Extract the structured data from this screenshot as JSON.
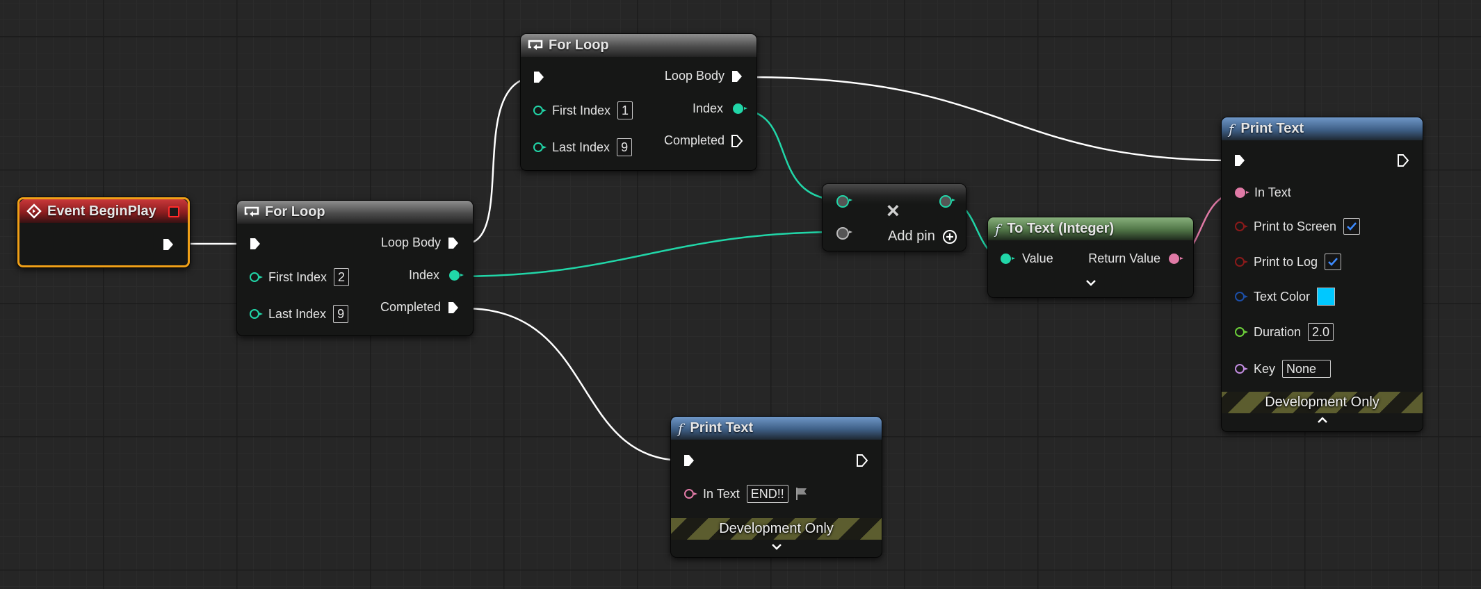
{
  "nodes": {
    "event_begin_play": {
      "title": "Event BeginPlay"
    },
    "for_loop_outer": {
      "title": "For Loop",
      "pins": {
        "loop_body": "Loop Body",
        "first_index": "First Index",
        "first_index_value": "2",
        "index": "Index",
        "last_index": "Last Index",
        "last_index_value": "9",
        "completed": "Completed"
      }
    },
    "for_loop_inner": {
      "title": "For Loop",
      "pins": {
        "loop_body": "Loop Body",
        "first_index": "First Index",
        "first_index_value": "1",
        "index": "Index",
        "last_index": "Last Index",
        "last_index_value": "9",
        "completed": "Completed"
      }
    },
    "multiply": {
      "add_pin": "Add pin",
      "symbol": "×"
    },
    "to_text": {
      "title": "To Text (Integer)",
      "pins": {
        "value": "Value",
        "return_value": "Return Value"
      }
    },
    "print_text_main": {
      "title": "Print Text",
      "pins": {
        "in_text": "In Text",
        "print_to_screen": "Print to Screen",
        "print_to_log": "Print to Log",
        "text_color": "Text Color",
        "duration": "Duration",
        "duration_value": "2.0",
        "key": "Key",
        "key_value": "None"
      },
      "print_to_screen_checked": true,
      "print_to_log_checked": true,
      "text_color_hex": "#00c8ff",
      "dev_label": "Development Only"
    },
    "print_text_end": {
      "title": "Print Text",
      "pins": {
        "in_text": "In Text",
        "in_text_value": "END!!"
      },
      "dev_label": "Development Only"
    }
  },
  "colors": {
    "exec": "#ffffff",
    "integer": "#21d6a8",
    "text": "#e07aa6",
    "bool": "#8a1a1a",
    "struct_color": "#1c4fa8",
    "float": "#6ccf3a",
    "name": "#c28ce0",
    "selection": "#f0a018"
  }
}
